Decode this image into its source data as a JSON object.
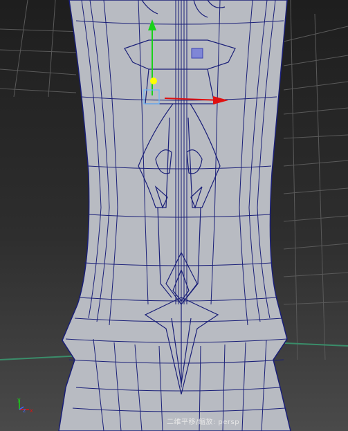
{
  "viewport": {
    "hud_label": "二维平移/缩放: persp",
    "colors": {
      "background_top": "#1e1e1e",
      "background_bottom": "#4a4a4a",
      "mesh_fill": "#b9bcc3",
      "wire": "#1a1f78",
      "grid": "#5c5c5c",
      "axis_y": "#19d119",
      "axis_x": "#e01010",
      "pivot": "#ffff00",
      "selected_face": "#7f86d6"
    }
  },
  "view_axis": {
    "x_label": "x",
    "y_label": "y",
    "z_label": "z"
  }
}
